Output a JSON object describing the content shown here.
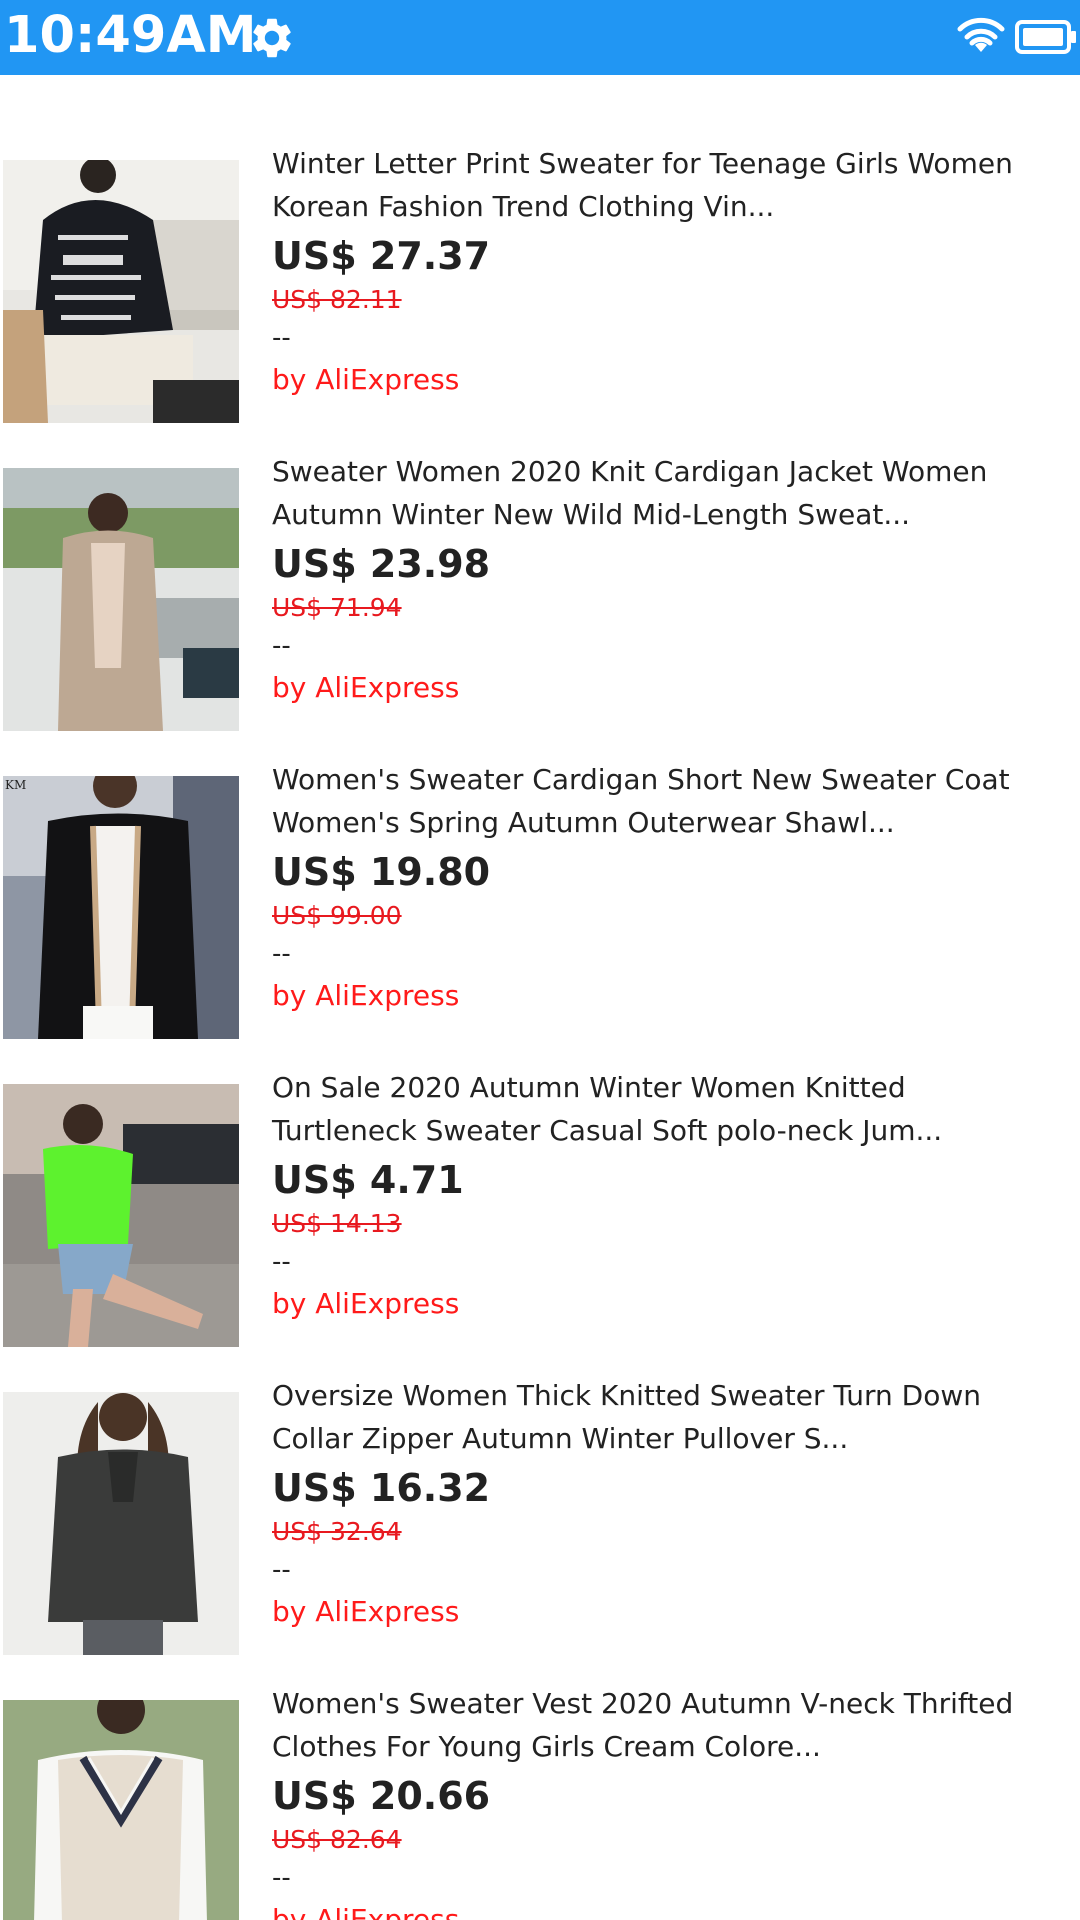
{
  "status_bar": {
    "time": "10:49AM",
    "background": "#2196f3",
    "icons": [
      "gear-icon",
      "wifi-icon",
      "battery-icon"
    ]
  },
  "products": [
    {
      "title_line1": "Winter Letter Print Sweater for Teenage Girls Women",
      "title_line2": "Korean Fashion Trend Clothing Vin...",
      "price": "US$ 27.37",
      "old_price": "US$ 82.11",
      "dash": "--",
      "seller": "by AliExpress",
      "image": "black-letter-print-sweater-photo"
    },
    {
      "title_line1": "Sweater Women 2020 Knit Cardigan Jacket Women",
      "title_line2": "Autumn Winter New Wild Mid-Length Sweat...",
      "price": "US$ 23.98",
      "old_price": "US$ 71.94",
      "dash": "--",
      "seller": "by AliExpress",
      "image": "beige-long-cardigan-photo"
    },
    {
      "title_line1": "Women's Sweater Cardigan Short New Sweater Coat",
      "title_line2": "Women's Spring Autumn Outerwear Shawl...",
      "price": "US$ 19.80",
      "old_price": "US$ 99.00",
      "dash": "--",
      "seller": "by AliExpress",
      "image": "black-short-cardigan-photo",
      "image_corner_text": "KM"
    },
    {
      "title_line1": "On Sale 2020 Autumn Winter Women Knitted",
      "title_line2": "Turtleneck Sweater Casual Soft polo-neck Jum...",
      "price": "US$ 4.71",
      "old_price": "US$ 14.13",
      "dash": "--",
      "seller": "by AliExpress",
      "image": "neon-green-turtleneck-photo"
    },
    {
      "title_line1": "Oversize Women Thick Knitted Sweater Turn Down",
      "title_line2": "Collar Zipper Autumn Winter Pullover S...",
      "price": "US$ 16.32",
      "old_price": "US$ 32.64",
      "dash": "--",
      "seller": "by AliExpress",
      "image": "grey-zipper-pullover-photo"
    },
    {
      "title_line1": "Women's Sweater Vest 2020 Autumn V-neck Thrifted",
      "title_line2": "Clothes For Young Girls Cream Colore...",
      "price": "US$ 20.66",
      "old_price": "US$ 82.64",
      "dash": "--",
      "seller": "by AliExpress",
      "image": "cream-sweater-vest-photo"
    }
  ],
  "colors": {
    "accent": "#2196f3",
    "sale_red": "#e8191f",
    "text": "#222222"
  }
}
